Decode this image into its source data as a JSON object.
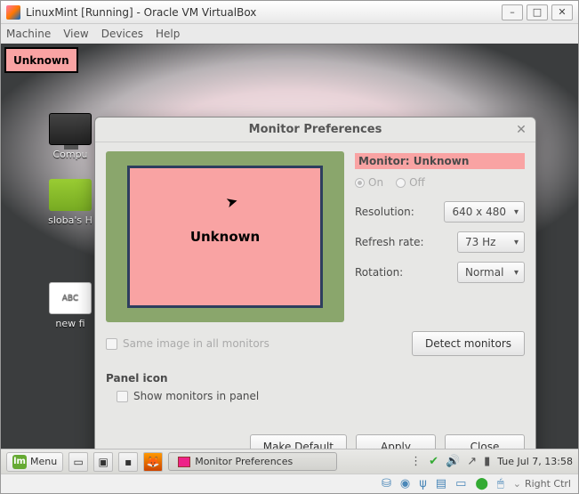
{
  "vbox": {
    "title": "LinuxMint [Running] - Oracle VM VirtualBox",
    "menu": {
      "machine": "Machine",
      "view": "View",
      "devices": "Devices",
      "help": "Help"
    },
    "status": {
      "right_ctrl": "Right Ctrl"
    }
  },
  "desktop": {
    "badge": "Unknown",
    "icons": {
      "computer": "Compu",
      "home": "sloba's H",
      "newfile_tag": "ABC",
      "newfile": "new fi"
    }
  },
  "dialog": {
    "title": "Monitor Preferences",
    "monitor_name": "Unknown",
    "props_label": "Monitor: Unknown",
    "radio_on": "On",
    "radio_off": "Off",
    "radio_selected": "on",
    "resolution_label": "Resolution:",
    "resolution_value": "640 x 480",
    "refresh_label": "Refresh rate:",
    "refresh_value": "73 Hz",
    "rotation_label": "Rotation:",
    "rotation_value": "Normal",
    "same_image": "Same image in all monitors",
    "detect": "Detect monitors",
    "panel_icon_hdr": "Panel icon",
    "show_monitors": "Show monitors in panel",
    "make_default": "Make Default",
    "apply": "Apply",
    "close": "Close"
  },
  "taskbar": {
    "menu": "Menu",
    "task": "Monitor Preferences",
    "clock": "Tue Jul  7, 13:58"
  },
  "colors": {
    "monitor_bg": "#f9a3a3",
    "canvas_bg": "#8aa66c"
  }
}
